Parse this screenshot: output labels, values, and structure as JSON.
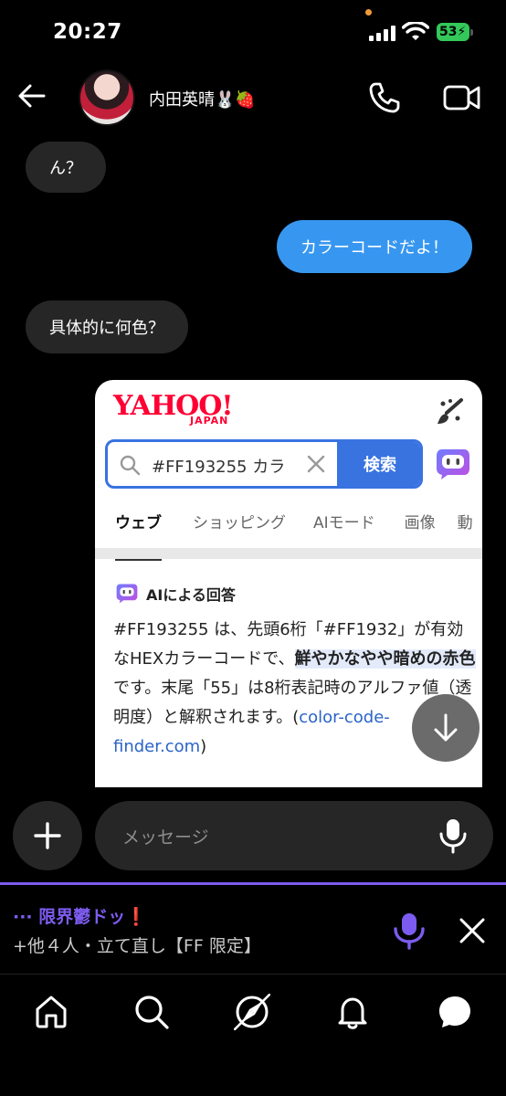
{
  "status_bar": {
    "time": "20:27",
    "battery": "53"
  },
  "header": {
    "contact_name": "内田英晴🐰🍓"
  },
  "messages": [
    {
      "from": "other",
      "text": "ん？"
    },
    {
      "from": "me",
      "text": "カラーコードだよ！"
    },
    {
      "from": "other",
      "text": "具体的に何色？"
    }
  ],
  "shared_card": {
    "logo": "YAHOO!",
    "logo_sub": "JAPAN",
    "search_query": "#FF193255 カラ",
    "search_button": "検索",
    "tabs": [
      "ウェブ",
      "ショッピング",
      "AIモード",
      "画像",
      "動"
    ],
    "ai_heading": "AIによる回答",
    "ai_text_1": "#FF193255 は、先頭6桁「#FF1932」が有効なHEXカラーコードで、",
    "ai_highlight": "鮮やかなやや暗めの赤色",
    "ai_text_2": "です。末尾「55」は8桁表記時のアルファ値（透明度）と解釈されます。(",
    "ai_link": "color-code-finder.com",
    "ai_text_3": ")"
  },
  "composer": {
    "placeholder": "メッセージ"
  },
  "voice_chat": {
    "title": "··· 限界鬱ドッ❗",
    "subtitle": "+他４人・立て直し【FF 限定】"
  },
  "bottom_nav": [
    "home-icon",
    "search-icon",
    "explore-icon",
    "notifications-icon",
    "messages-icon"
  ],
  "colors": {
    "bubble_me": "#3797f0",
    "bubble_other": "#262626",
    "accent_purple": "#7c5cf0",
    "yahoo_red": "#ff0033",
    "yahoo_blue": "#3873e0"
  }
}
